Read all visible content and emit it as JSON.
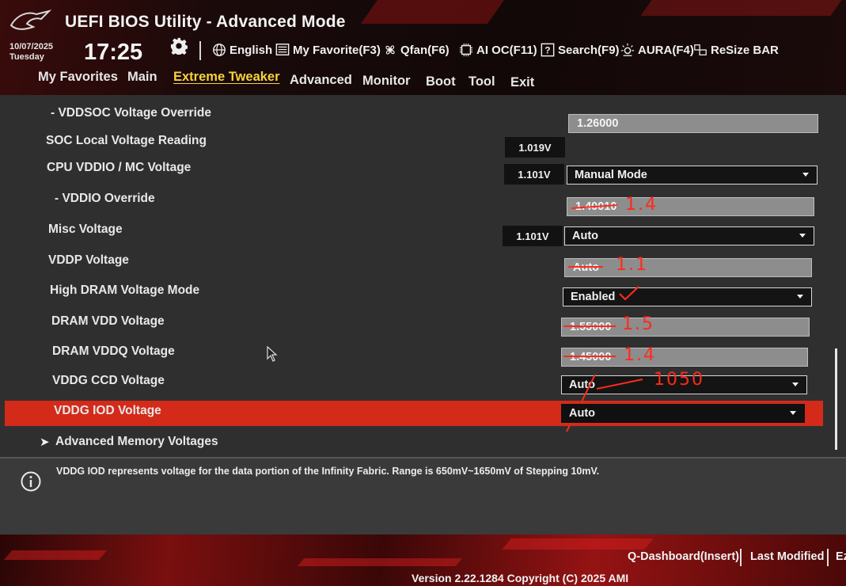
{
  "header": {
    "title": "UEFI BIOS Utility - Advanced Mode",
    "date": "10/07/2025",
    "day": "Tuesday",
    "time": "17:25",
    "tools": {
      "language": "English",
      "my_favorite": "My Favorite(F3)",
      "qfan": "Qfan(F6)",
      "ai_oc": "AI OC(F11)",
      "search": "Search(F9)",
      "aura": "AURA(F4)",
      "resize_bar": "ReSize BAR"
    }
  },
  "nav": {
    "tabs": [
      "My Favorites",
      "Main",
      "Extreme Tweaker",
      "Advanced",
      "Monitor",
      "Boot",
      "Tool",
      "Exit"
    ],
    "active": "Extreme Tweaker"
  },
  "settings": {
    "vddsoc_override": {
      "label": "- VDDSOC Voltage Override",
      "value": "1.26000"
    },
    "soc_local_reading": {
      "label": "SOC Local Voltage Reading",
      "reading": "1.019V"
    },
    "cpu_vddio": {
      "label": "CPU VDDIO / MC Voltage",
      "reading": "1.101V",
      "value": "Manual Mode"
    },
    "vddio_override": {
      "label": "- VDDIO Override",
      "value": "1.40010",
      "annotation": "1.4"
    },
    "misc_voltage": {
      "label": "Misc Voltage",
      "reading": "1.101V",
      "value": "Auto"
    },
    "vddp_voltage": {
      "label": "VDDP Voltage",
      "value": "Auto",
      "annotation": "1.1"
    },
    "high_dram_mode": {
      "label": "High DRAM Voltage Mode",
      "value": "Enabled"
    },
    "dram_vdd": {
      "label": "DRAM VDD Voltage",
      "value": "1.55000",
      "annotation": "1.5"
    },
    "dram_vddq": {
      "label": "DRAM VDDQ Voltage",
      "value": "1.45000",
      "annotation": "1.4"
    },
    "vddg_ccd": {
      "label": "VDDG CCD Voltage",
      "value": "Auto",
      "annotation": "1050"
    },
    "vddg_iod": {
      "label": "VDDG IOD Voltage",
      "value": "Auto"
    },
    "advanced_memory": {
      "label": "Advanced Memory Voltages"
    }
  },
  "help_text": "VDDG IOD represents voltage for the data portion of the Infinity Fabric. Range is 650mV~1650mV of Stepping 10mV.",
  "footer": {
    "q_dashboard": "Q-Dashboard(Insert)",
    "last_modified": "Last Modified",
    "ez_mode": "Ez",
    "version": "Version 2.22.1284 Copyright (C) 2025 AMI"
  },
  "colors": {
    "accent_red": "#d42a1a",
    "active_tab": "#f6d33a",
    "annotation_red": "#ff2a1a"
  }
}
